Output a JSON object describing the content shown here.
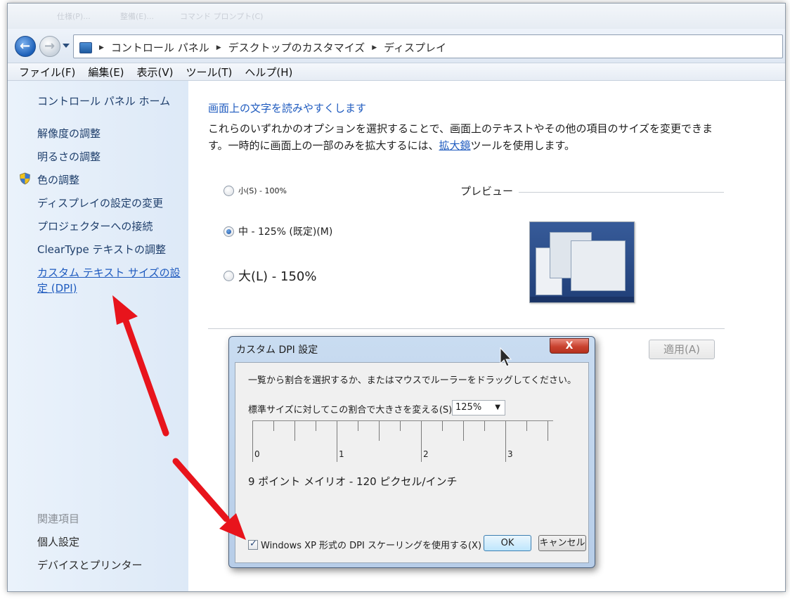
{
  "titlestrip": {
    "tabs": [
      "仕様(P)...",
      "整備(E)...",
      "コマンド プロンプト(C)"
    ]
  },
  "address": {
    "crumbs": [
      "コントロール パネル",
      "デスクトップのカスタマイズ",
      "ディスプレイ"
    ]
  },
  "menubar": {
    "items": [
      "ファイル(F)",
      "編集(E)",
      "表示(V)",
      "ツール(T)",
      "ヘルプ(H)"
    ]
  },
  "sidebar": {
    "home": "コントロール パネル ホーム",
    "items": [
      "解像度の調整",
      "明るさの調整",
      "色の調整",
      "ディスプレイの設定の変更",
      "プロジェクターへの接続",
      "ClearType テキストの調整"
    ],
    "custom_link": "カスタム テキスト サイズの設定 (DPI)",
    "related_header": "関連項目",
    "related": [
      "個人設定",
      "デバイスとプリンター"
    ]
  },
  "main": {
    "title": "画面上の文字を読みやすくします",
    "desc_part1": "これらのいずれかのオプションを選択することで、画面上のテキストやその他の項目のサイズを変更できます。一時的に画面上の一部のみを拡大するには、",
    "desc_link": "拡大鏡",
    "desc_part2": "ツールを使用します。",
    "options": [
      {
        "label": "小(S) - 100%",
        "checked": false
      },
      {
        "label": "中 - 125% (既定)(M)",
        "checked": true
      },
      {
        "label": "大(L) - 150%",
        "checked": false
      }
    ],
    "preview_label": "プレビュー",
    "apply": "適用(A)"
  },
  "dialog": {
    "title": "カスタム DPI 設定",
    "close": "X",
    "instruction": "一覧から割合を選択するか、またはマウスでルーラーをドラッグしてください。",
    "scale_label": "標準サイズに対してこの割合で大きさを変える(S):",
    "scale_value": "125%",
    "ruler_numbers": [
      "0",
      "1",
      "2",
      "3"
    ],
    "info": "9 ポイント メイリオ - 120 ピクセル/インチ",
    "xp_checkbox": "Windows XP 形式の DPI スケーリングを使用する(X)",
    "xp_checked": true,
    "ok": "OK",
    "cancel": "キャンセル"
  },
  "colors": {
    "link": "#1f5bbf",
    "annotation_arrow": "#e8141c"
  }
}
